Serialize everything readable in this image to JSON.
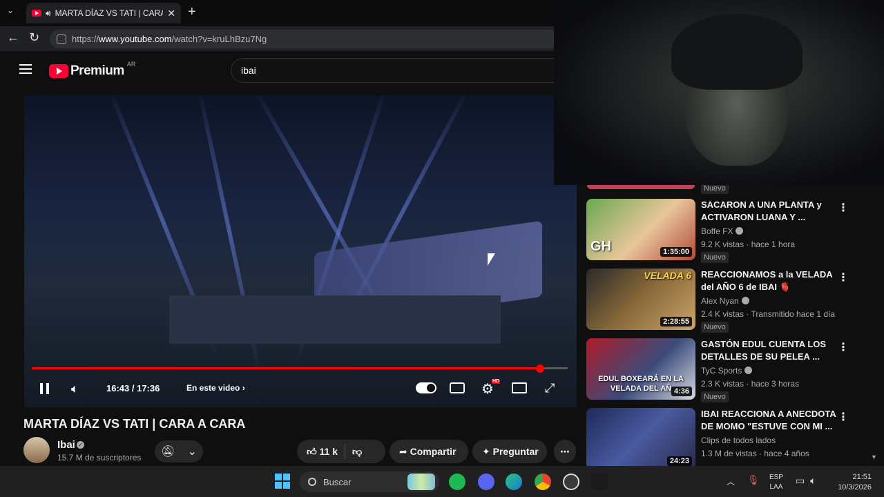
{
  "browser": {
    "tab_title": "MARTA DÍAZ VS TATI | CARA A",
    "url_prefix": "https://",
    "url_domain": "www.youtube.com",
    "url_path": "/watch?v=kruLhBzu7Ng"
  },
  "youtube": {
    "logo_text": "Premium",
    "region": "AR",
    "search_value": "ibai"
  },
  "player": {
    "current_time": "16:43 / 17:36",
    "chapter_label": "En este video",
    "progress_fraction": 0.949
  },
  "video": {
    "title": "MARTA DÍAZ VS TATI | CARA A CARA",
    "channel": "Ibai",
    "subscribers": "15.7 M de suscriptores",
    "likes": "11 k",
    "share_label": "Compartir",
    "ask_label": "Preguntar"
  },
  "sidebar": {
    "top_badge": "Nuevo",
    "items": [
      {
        "title": "SACARON A UNA PLANTA y ACTIVARON LUANA Y ...",
        "channel": "Boffe FX",
        "meta": "9.2 K vistas · hace 1 hora",
        "badge": "Nuevo",
        "duration": "1:35:00",
        "thumb_text": "GH"
      },
      {
        "title": "REACCIONAMOS a la VELADA del AÑO 6 de IBAI 🫀",
        "channel": "Alex Nyan",
        "meta": "2.4 K vistas · Transmitido hace 1 día",
        "badge": "Nuevo",
        "duration": "2:28:55",
        "thumb_text": "VELADA 6"
      },
      {
        "title": "GASTÓN EDUL CUENTA LOS DETALLES DE SU PELEA ...",
        "channel": "TyC Sports",
        "meta": "2.3 K vistas · hace 3 horas",
        "badge": "Nuevo",
        "duration": "4:36",
        "thumb_text": "EDUL BOXEARÁ EN LA VELADA DEL AÑ"
      },
      {
        "title": "IBAI REACCIONA A ANECDOTA DE MOMO \"ESTUVE CON MI ...",
        "channel": "Clips de todos lados",
        "meta": "1.3 M de vistas · hace 4 años",
        "badge": "",
        "duration": "24:23",
        "thumb_text": ""
      }
    ]
  },
  "taskbar": {
    "search_placeholder": "Buscar",
    "lang_line1": "ESP",
    "lang_line2": "LAA",
    "time": "21:51",
    "date": "10/3/2026"
  }
}
